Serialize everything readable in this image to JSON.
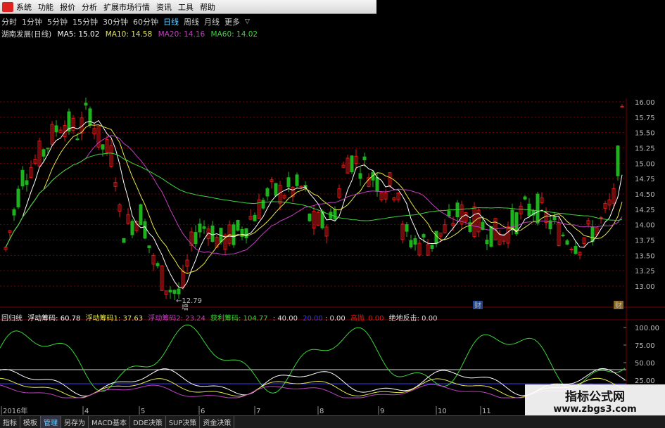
{
  "menubar": {
    "items": [
      "系统",
      "功能",
      "报价",
      "分析",
      "扩展市场行情",
      "资讯",
      "工具",
      "帮助"
    ]
  },
  "period_bar": {
    "items": [
      "分时",
      "1分钟",
      "5分钟",
      "15分钟",
      "30分钟",
      "60分钟",
      "日线",
      "周线",
      "月线",
      "更多"
    ],
    "active": "日线",
    "more_arrow": "▽"
  },
  "ma_line": {
    "stock": "湖南发展(日线)",
    "ma5": "MA5: 15.02",
    "ma10": "MA10: 14.58",
    "ma20": "MA20: 14.16",
    "ma60": "MA60: 14.02"
  },
  "colors": {
    "up": "#e01818",
    "down": "#1fb21f",
    "ma5": "#ffffff",
    "ma10": "#e8e84a",
    "ma20": "#c040c0",
    "ma60": "#3cd63c",
    "grid": "#7a0000"
  },
  "price_axis": {
    "ticks": [
      "16.00",
      "15.75",
      "15.50",
      "15.25",
      "15.00",
      "14.75",
      "14.50",
      "14.25",
      "14.00",
      "13.75",
      "13.50",
      "13.25",
      "13.00"
    ],
    "low_label": "12.79",
    "low_marker": "增",
    "cai_marker_1": "财",
    "cai_marker_2": "财"
  },
  "indicator_line": {
    "name": "回归统",
    "float1": "浮动筹码: 60.78",
    "float2": "浮动筹码1: 37.63",
    "float3": "浮动筹码2: 23.24",
    "profit": "获利筹码: 104.77",
    "v40": ": 40.00",
    "v_blue": "20.00",
    "v_blue_tail": ": 0.00",
    "v_high": "高抛",
    "v_high_val": "0.00",
    "v_final": "绝地反击: 0.00"
  },
  "indicator_axis": {
    "ticks": [
      "100.00",
      "75.00",
      "50.00",
      "25.00"
    ]
  },
  "time_axis": {
    "labels": [
      "2016年",
      "4",
      "5",
      "6",
      "7",
      "8",
      "9",
      "10",
      "11"
    ]
  },
  "bottom_bar": {
    "items": [
      "指标",
      "模板",
      "管理",
      "另存为",
      "MACD基本",
      "DDE决策",
      "SUP决策",
      "资金决策"
    ],
    "active": "管理"
  },
  "watermark": {
    "line1": "指标公式网",
    "line2": "www.zbgs3.com"
  }
}
